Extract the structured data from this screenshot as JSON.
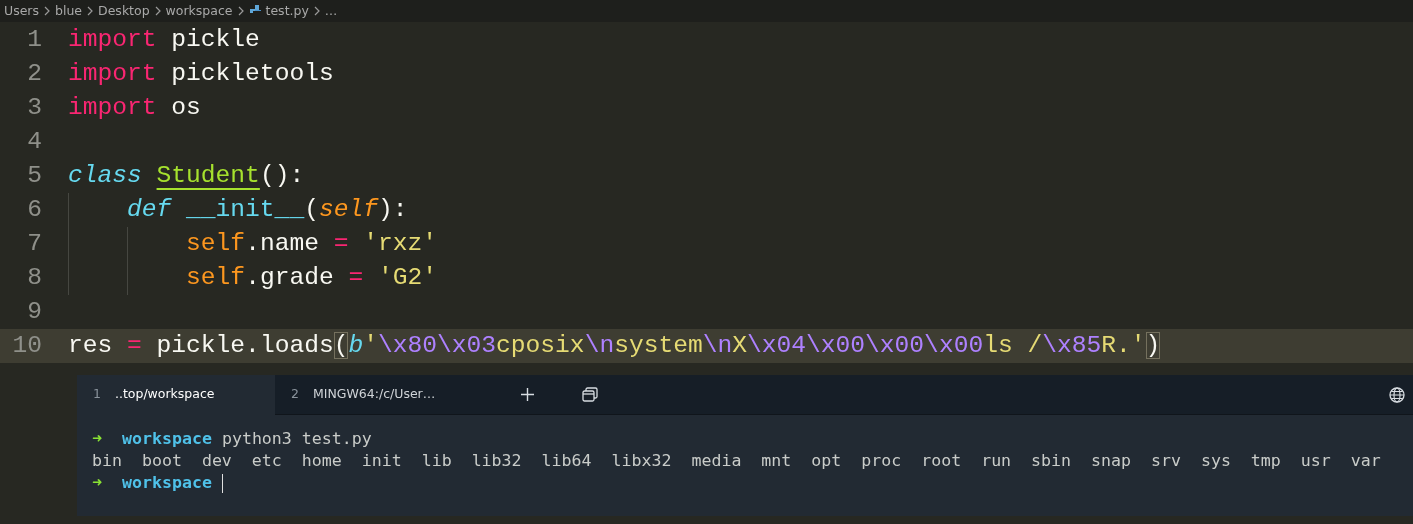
{
  "breadcrumb": [
    {
      "label": "Users",
      "kind": "folder"
    },
    {
      "label": "blue",
      "kind": "folder"
    },
    {
      "label": "Desktop",
      "kind": "folder"
    },
    {
      "label": "workspace",
      "kind": "folder"
    },
    {
      "label": "test.py",
      "kind": "python"
    },
    {
      "label": "…",
      "kind": "more"
    }
  ],
  "editor": {
    "lines": [
      {
        "number": "1",
        "current": false,
        "tokens": [
          {
            "text": "import",
            "kind": "keyword"
          },
          {
            "text": " pickle",
            "kind": "plain"
          }
        ]
      },
      {
        "number": "2",
        "current": false,
        "tokens": [
          {
            "text": "import",
            "kind": "keyword"
          },
          {
            "text": " pickletools",
            "kind": "plain"
          }
        ]
      },
      {
        "number": "3",
        "current": false,
        "tokens": [
          {
            "text": "import",
            "kind": "keyword"
          },
          {
            "text": " os",
            "kind": "plain"
          }
        ]
      },
      {
        "number": "4",
        "current": false
      },
      {
        "number": "5",
        "current": false,
        "tokens": [
          {
            "text": "class ",
            "kind": "storage"
          },
          {
            "text": "Student",
            "kind": "classname"
          },
          {
            "text": "():",
            "kind": "plain"
          }
        ],
        "children": [
          {
            "number": "6",
            "current": false,
            "tokens": [
              {
                "text": "def",
                "kind": "storage"
              },
              {
                "text": " __init__",
                "kind": "function"
              },
              {
                "text": "(",
                "kind": "plain"
              },
              {
                "text": "self",
                "kind": "param"
              },
              {
                "text": "):",
                "kind": "plain"
              }
            ],
            "children": [
              {
                "number": "7",
                "current": false,
                "tokens": [
                  {
                    "text": "self",
                    "kind": "self"
                  },
                  {
                    "text": ".name ",
                    "kind": "plain"
                  },
                  {
                    "text": "= ",
                    "kind": "keyword"
                  },
                  {
                    "text": "'rxz'",
                    "kind": "string"
                  }
                ]
              },
              {
                "number": "8",
                "current": false,
                "tokens": [
                  {
                    "text": "self",
                    "kind": "self"
                  },
                  {
                    "text": ".grade ",
                    "kind": "plain"
                  },
                  {
                    "text": "= ",
                    "kind": "keyword"
                  },
                  {
                    "text": "'G2'",
                    "kind": "string"
                  }
                ]
              }
            ]
          }
        ]
      },
      {
        "number": "9",
        "current": false
      },
      {
        "number": "10",
        "current": true,
        "tokens": [
          {
            "text": "res ",
            "kind": "plain"
          },
          {
            "text": "=",
            "kind": "keyword"
          },
          {
            "text": " pickle.loads",
            "kind": "plain"
          },
          {
            "text": "(",
            "kind": "bracket_match"
          },
          {
            "text": "b",
            "kind": "storage"
          },
          {
            "text": "'",
            "kind": "string"
          },
          {
            "text": "\\x80\\x03",
            "kind": "escape"
          },
          {
            "text": "cposix",
            "kind": "string"
          },
          {
            "text": "\\n",
            "kind": "escape"
          },
          {
            "text": "system",
            "kind": "string"
          },
          {
            "text": "\\n",
            "kind": "escape"
          },
          {
            "text": "X",
            "kind": "string"
          },
          {
            "text": "\\x04\\x00\\x00\\x00",
            "kind": "escape"
          },
          {
            "text": "ls /",
            "kind": "string"
          },
          {
            "text": "\\x85",
            "kind": "escape"
          },
          {
            "text": "R.'",
            "kind": "string"
          },
          {
            "text": ")",
            "kind": "bracket_match"
          }
        ]
      }
    ]
  },
  "terminal": {
    "tabs": [
      {
        "number": "1",
        "label": "..top/workspace",
        "selected": true
      },
      {
        "number": "2",
        "label": "MINGW64:/c/User…",
        "selected": false
      }
    ],
    "lines": [
      {
        "kind": "prompt",
        "arrow": "➜",
        "directory": "workspace",
        "command": "python3 test.py",
        "cursor": false
      },
      {
        "kind": "output",
        "text": "bin  boot  dev  etc  home  init  lib  lib32  lib64  libx32  media  mnt  opt  proc  root  run  sbin  snap  srv  sys  tmp  usr  var"
      },
      {
        "kind": "prompt",
        "arrow": "➜",
        "directory": "workspace",
        "cursor": true
      }
    ]
  }
}
